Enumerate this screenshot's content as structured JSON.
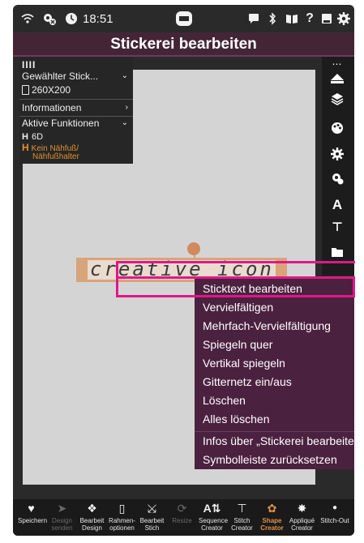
{
  "status_bar": {
    "time": "18:51",
    "icons": [
      "wifi-icon",
      "settings-gear-small-icon",
      "clock-icon",
      "machine-icon",
      "message-icon",
      "bluetooth-icon",
      "book-icon",
      "help-icon",
      "save-icon",
      "gear-icon"
    ]
  },
  "title": "Stickerei bearbeiten",
  "info_panel": {
    "selected_design_label": "Gewählter Stick...",
    "hoop_size": "260X200",
    "information_label": "Informationen",
    "active_functions_label": "Aktive Funktionen",
    "function_6d": "6D",
    "warning_line1": "Kein Nähfuß/",
    "warning_line2": "Nähfußhalter"
  },
  "design_text": "creative icon",
  "context_menu": {
    "items": [
      "Sticktext bearbeiten",
      "Vervielfältigen",
      "Mehrfach-Vervielfältigung",
      "Spiegeln quer",
      "Vertikal spiegeln",
      "Gitternetz ein/aus",
      "Löschen",
      "Alles löschen"
    ],
    "footer_items": [
      "Infos über „Stickerei bearbeite",
      "Symbolleiste zurücksetzen"
    ]
  },
  "bottom_toolbar": [
    {
      "icon": "heart-icon",
      "label1": "Speichern",
      "label2": "",
      "state": "normal"
    },
    {
      "icon": "send-icon",
      "label1": "Design",
      "label2": "senden",
      "state": "dim"
    },
    {
      "icon": "edit-design-icon",
      "label1": "Bearbeit",
      "label2": "Design",
      "state": "normal"
    },
    {
      "icon": "hoop-options-icon",
      "label1": "Rahmen-",
      "label2": "optionen",
      "state": "normal"
    },
    {
      "icon": "edit-stitch-icon",
      "label1": "Bearbeit",
      "label2": "Stich",
      "state": "normal"
    },
    {
      "icon": "resize-icon",
      "label1": "Resize",
      "label2": "",
      "state": "dim"
    },
    {
      "icon": "sequence-creator-icon",
      "label1": "Sequence",
      "label2": "Creator",
      "state": "normal"
    },
    {
      "icon": "stitch-creator-icon",
      "label1": "Stitch",
      "label2": "Creator",
      "state": "normal"
    },
    {
      "icon": "shape-creator-icon",
      "label1": "Shape",
      "label2": "Creator",
      "state": "active"
    },
    {
      "icon": "applique-creator-icon",
      "label1": "Appliqué",
      "label2": "Creator",
      "state": "normal"
    },
    {
      "icon": "stitch-out-icon",
      "label1": "Stitch-Out",
      "label2": "",
      "state": "normal"
    }
  ],
  "colors": {
    "title_bar": "#442535",
    "context_menu": "#4b2140",
    "accent_orange": "#e09245",
    "highlight_pink": "#e01888"
  }
}
